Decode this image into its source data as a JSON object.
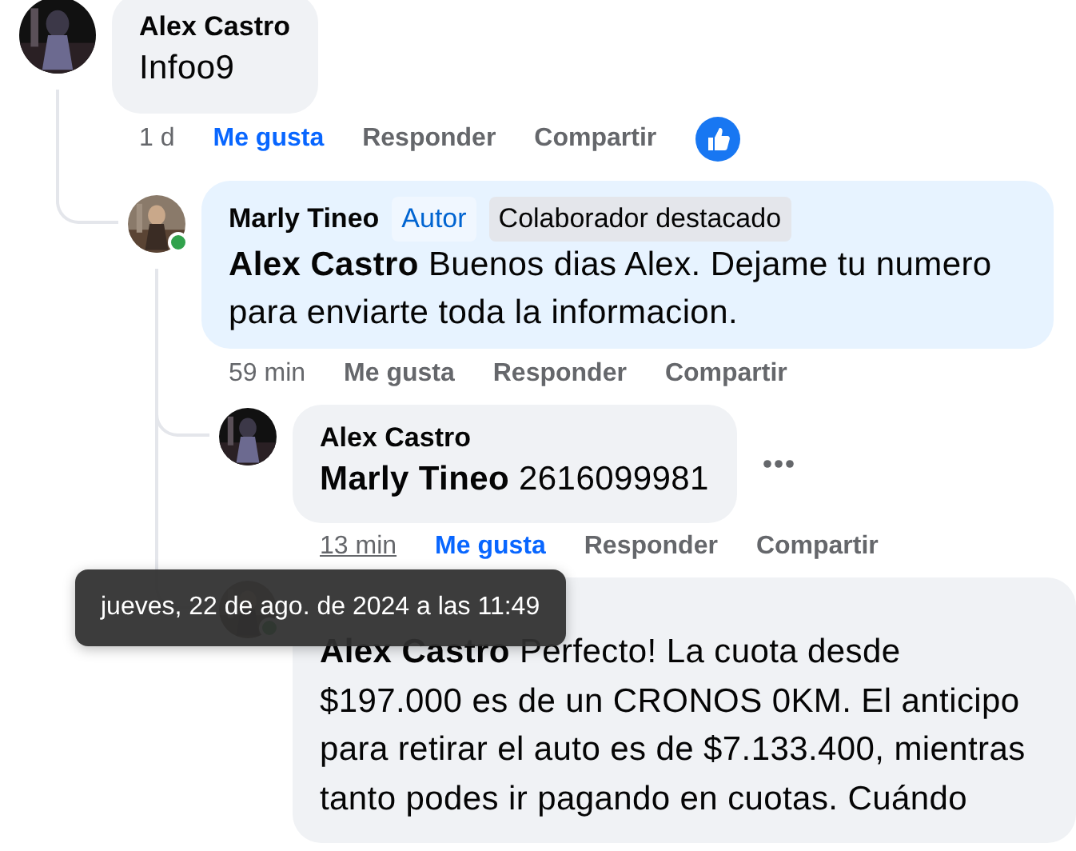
{
  "comments": [
    {
      "author": "Alex Castro",
      "highlighted": false,
      "body": "Infoo9",
      "time": "1 d",
      "time_hovered": false,
      "like": {
        "label": "Me gusta",
        "liked": true
      },
      "reply": "Responder",
      "share": "Compartir",
      "has_reactions": true,
      "replies": [
        {
          "author": "Marly Tineo",
          "online": true,
          "highlighted": true,
          "badges": [
            {
              "label": "Autor",
              "kind": "author"
            },
            {
              "label": "Colaborador destacado",
              "kind": "top_contributor"
            }
          ],
          "body": "**Alex Castro** Buenos dias Alex. Dejame tu numero para enviarte toda la informacion.",
          "time": "59 min",
          "time_hovered": false,
          "like": {
            "label": "Me gusta",
            "liked": false
          },
          "reply": "Responder",
          "share": "Compartir",
          "replies": [
            {
              "author": "Alex Castro",
              "highlighted": false,
              "body": "**Marly Tineo** 2616099981",
              "time": "13 min",
              "time_hovered": true,
              "like": {
                "label": "Me gusta",
                "liked": true
              },
              "reply": "Responder",
              "share": "Compartir",
              "more_menu": true
            },
            {
              "online": true,
              "highlighted": false,
              "body": "**Alex Castro** Perfecto! La cuota desde $197.000 es de un CRONOS 0KM. El anticipo para retirar el auto es de $7.133.400, mientras tanto podes ir pagando en cuotas. Cuándo"
            }
          ]
        }
      ]
    }
  ],
  "tooltip": {
    "text": "jueves, 22 de ago. de 2024 a las 11:49"
  }
}
